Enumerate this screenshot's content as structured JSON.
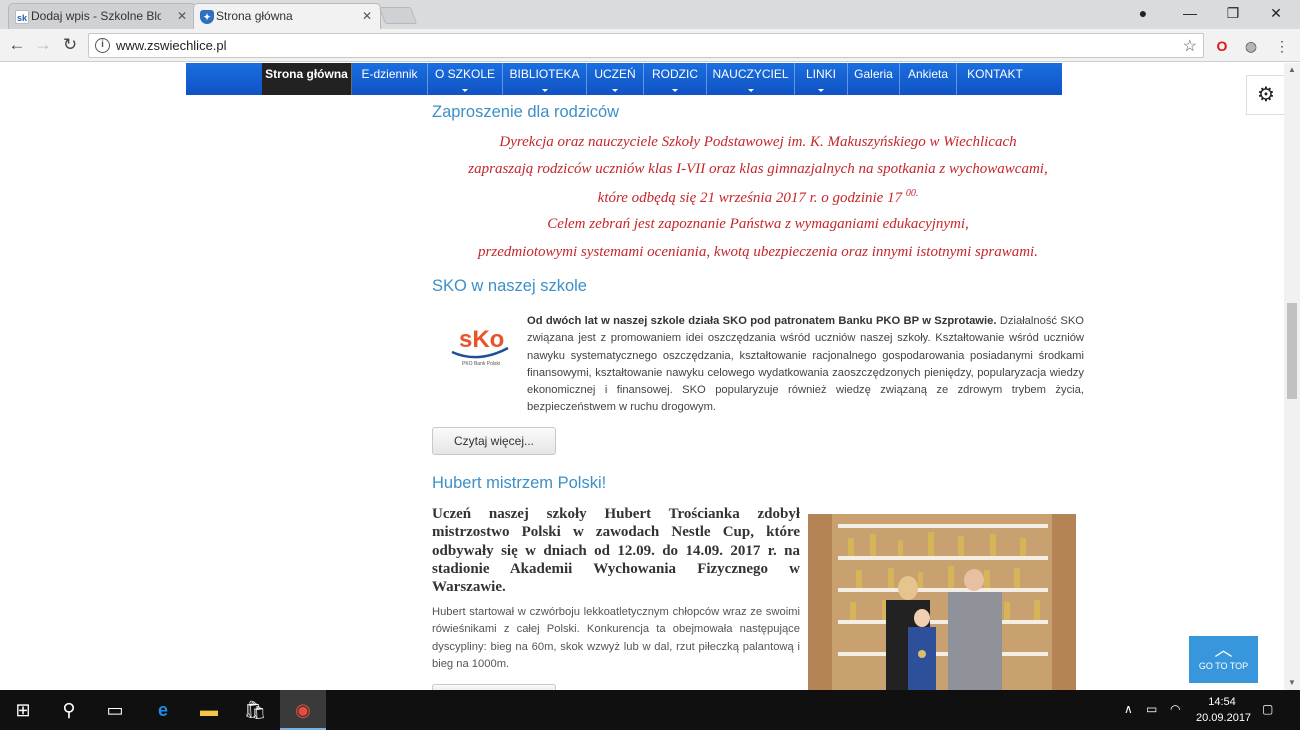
{
  "browser": {
    "tabs": [
      {
        "title": "Dodaj wpis - Szkolne Blo",
        "favicon": "sko-favicon",
        "active": false
      },
      {
        "title": "Strona główna",
        "favicon": "shield-favicon",
        "active": true
      }
    ],
    "url": "www.zswiechlice.pl"
  },
  "nav": {
    "items": [
      {
        "label": "Strona główna",
        "active": true,
        "dropdown": false
      },
      {
        "label": "E-dziennik",
        "active": false,
        "dropdown": false
      },
      {
        "label": "O SZKOLE",
        "active": false,
        "dropdown": true
      },
      {
        "label": "BIBLIOTEKA",
        "active": false,
        "dropdown": true
      },
      {
        "label": "UCZEŃ",
        "active": false,
        "dropdown": true
      },
      {
        "label": "RODZIC",
        "active": false,
        "dropdown": true
      },
      {
        "label": "NAUCZYCIEL",
        "active": false,
        "dropdown": true
      },
      {
        "label": "LINKI",
        "active": false,
        "dropdown": true
      },
      {
        "label": "Galeria",
        "active": false,
        "dropdown": false
      },
      {
        "label": "Ankieta",
        "active": false,
        "dropdown": false
      },
      {
        "label": "KONTAKT",
        "active": false,
        "dropdown": false
      }
    ]
  },
  "articles": {
    "invite": {
      "title": "Zaproszenie dla rodziców",
      "lines": [
        "Dyrekcja oraz nauczyciele Szkoły Podstawowej im. K. Makuszyńskiego w Wiechlicach",
        "zapraszają rodziców uczniów klas I-VII oraz klas gimnazjalnych na spotkania z wychowawcami,",
        "które odbędą się 21 września 2017 r. o godzinie 17",
        "Celem zebrań jest zapoznanie Państwa z wymaganiami edukacyjnymi,",
        "przedmiotowymi systemami oceniania, kwotą ubezpieczenia oraz innymi istotnymi sprawami."
      ],
      "time_sup": "00."
    },
    "sko": {
      "title": "SKO w naszej szkole",
      "logo_text": "sKo",
      "logo_sub": "PKO Bank Polski",
      "lead": "Od dwóch lat w naszej szkole działa SKO pod patronatem Banku PKO BP w Szprotawie.",
      "body": "Działalność SKO związana jest z promowaniem idei oszczędzania wśród uczniów naszej szkoły. Kształtowanie wśród uczniów nawyku systematycznego oszczędzania, kształtowanie racjonalnego gospodarowania posiadanymi środkami finansowymi, kształtowanie nawyku celowego wydatkowania zaoszczędzonych pieniędzy, popularyzacja wiedzy ekonomicznej i finansowej. SKO popularyzuje również wiedzę związaną ze zdrowym trybem życia, bezpieczeństwem w ruchu drogowym.",
      "read_more": "Czytaj więcej..."
    },
    "hubert": {
      "title": "Hubert mistrzem Polski!",
      "lead": "Uczeń naszej szkoły Hubert Trościanka zdobył mistrzostwo Polski w zawodach Nestle Cup, które odbywały się w dniach od 12.09. do 14.09. 2017 r. na stadionie Akademii Wychowania Fizycznego w Warszawie.",
      "body": "Hubert startował w czwórboju lekkoatletycznym chłopców wraz ze swoimi rówieśnikami z całej Polski.  Konkurencja ta obejmowała następujące dyscypliny: bieg na 60m, skok wzwyż lub w dal, rzut piłeczką palantową i bieg na 1000m."
    }
  },
  "go_to_top": "GO TO TOP",
  "taskbar": {
    "time": "14:54",
    "date": "20.09.2017"
  },
  "colors": {
    "menu_blue": "#1565d8",
    "heading_blue": "#3d8fc8",
    "invite_red": "#c6262b",
    "gototop_blue": "#3897dc"
  }
}
